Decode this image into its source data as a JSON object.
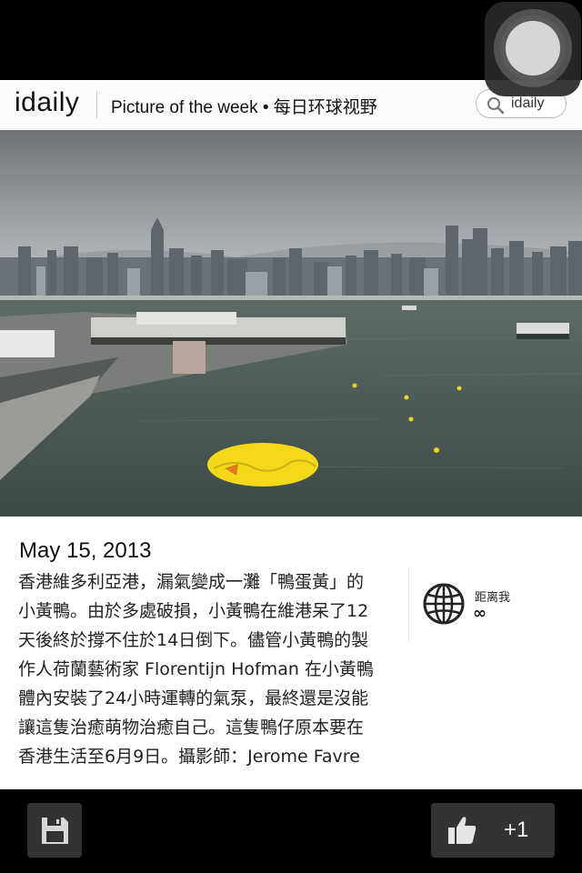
{
  "app": {
    "logo": "idaily",
    "tagline": "Picture of the week • 每日环球视野"
  },
  "search": {
    "label": "idaily",
    "icon": "search-icon"
  },
  "photo": {
    "subject": ""
  },
  "article": {
    "date": "May 15, 2013",
    "body": "香港維多利亞港，漏氣變成一灘「鴨蛋黃」的\n小黃鴨。由於多處破損，小黃鴨在維港呆了12\n天後終於撐不住於14日倒下。儘管小黃鴨的製\n作人荷蘭藝術家 Florentijn Hofman 在小黃鴨\n體內安裝了24小時運轉的氣泵，最終還是沒能\n讓這隻治癒萌物治癒自己。這隻鴨仔原本要在\n香港生活至6月9日。攝影師：Jerome Favre"
  },
  "distance": {
    "label": "距离我",
    "value": "∞",
    "icon": "globe-icon"
  },
  "toolbar": {
    "save_icon": "floppy-disk-icon",
    "like_icon": "thumbs-up-icon",
    "like_label": "+1"
  },
  "colors": {
    "duck_yellow": "#f3d91a",
    "harbor_water": "#4a5a57",
    "sky": "#8c9096"
  }
}
